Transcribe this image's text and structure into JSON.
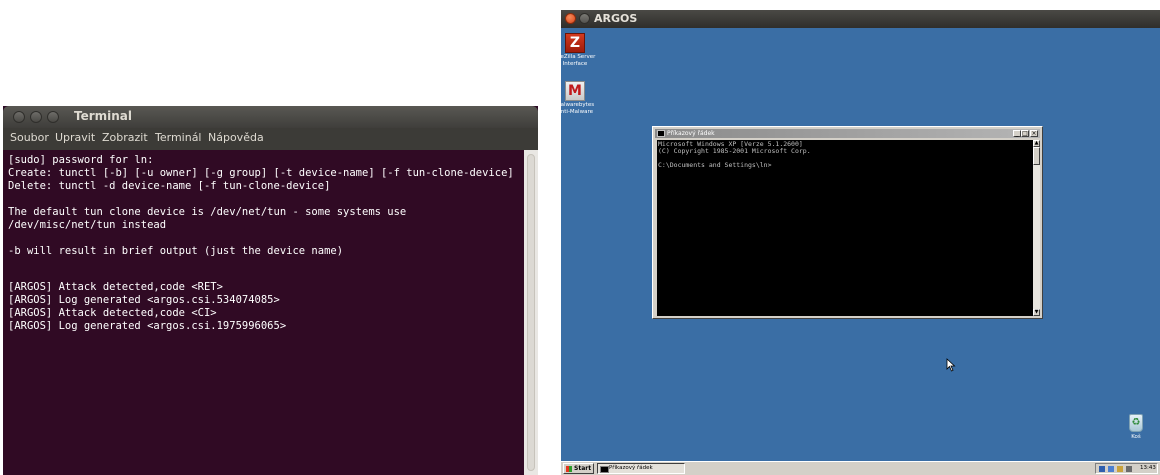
{
  "terminal": {
    "title": "Terminal",
    "menu": [
      "Soubor",
      "Upravit",
      "Zobrazit",
      "Terminál",
      "Nápověda"
    ],
    "lines": [
      "[sudo] password for ln:",
      "Create: tunctl [-b] [-u owner] [-g group] [-t device-name] [-f tun-clone-device]",
      "Delete: tunctl -d device-name [-f tun-clone-device]",
      "",
      "The default tun clone device is /dev/net/tun - some systems use",
      "/dev/misc/net/tun instead",
      "",
      "-b will result in brief output (just the device name)",
      "",
      "[ARGOS] Attack detected,code <RET>",
      "[ARGOS] Log generated <argos.csi.534074085>",
      "[ARGOS] Attack detected,code <CI>",
      "[ARGOS] Log generated <argos.csi.1975996065>"
    ]
  },
  "vm": {
    "title": "ARGOS",
    "desktop_icons": [
      {
        "label_line1": "FileZilla Server",
        "label_line2": "Interface",
        "icon": "filezilla-icon"
      },
      {
        "label_line1": "Malwarebytes",
        "label_line2": "Anti-Malware",
        "icon": "malwarebytes-icon"
      },
      {
        "label_line1": "Koš",
        "label_line2": "",
        "icon": "recycle-bin-icon"
      }
    ],
    "cmd": {
      "title": "Příkazový řádek",
      "controls": [
        "_",
        "□",
        "×"
      ],
      "lines": [
        "Microsoft Windows XP [Verze 5.1.2600]",
        "(C) Copyright 1985-2001 Microsoft Corp.",
        "",
        "C:\\Documents and Settings\\ln>"
      ]
    },
    "taskbar": {
      "start_label": "Start",
      "task_label": "Příkazový řádek",
      "clock": "13:43"
    }
  }
}
